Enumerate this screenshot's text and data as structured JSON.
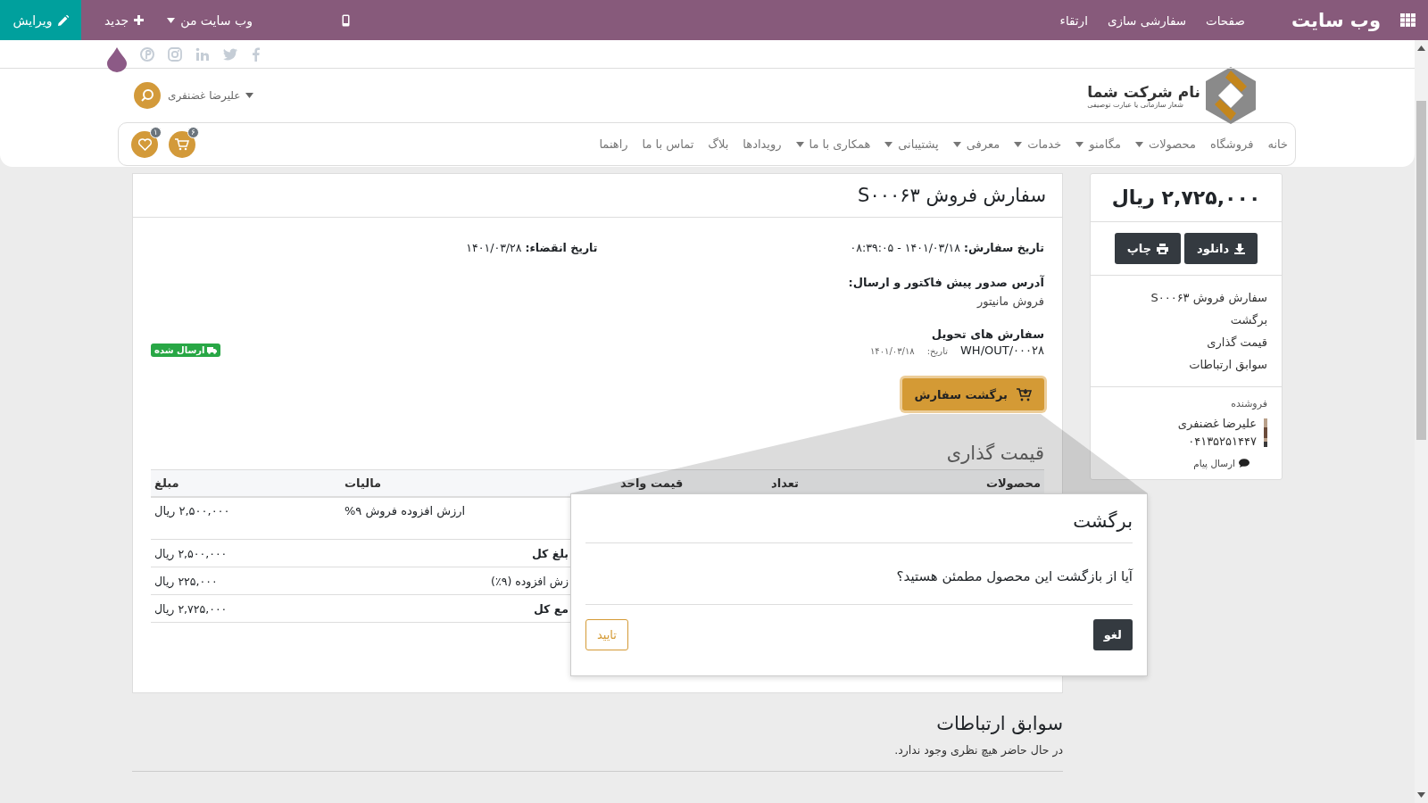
{
  "topbar": {
    "title": "وب سایت",
    "menu": [
      "صفحات",
      "سفارشی سازی",
      "ارتقاء"
    ],
    "website_menu": "وب سایت من",
    "new_button": "جدید",
    "edit_button": "ویرایش"
  },
  "header": {
    "company_name": "نام شرکت شما",
    "company_slogan": "شعار سازمانی یا عبارت توصیفی",
    "user": "علیرضا غضنفری"
  },
  "nav": {
    "items": [
      {
        "label": "خانه",
        "dropdown": false
      },
      {
        "label": "فروشگاه",
        "dropdown": false
      },
      {
        "label": "محصولات",
        "dropdown": true
      },
      {
        "label": "مگامنو",
        "dropdown": true
      },
      {
        "label": "خدمات",
        "dropdown": true
      },
      {
        "label": "معرفی",
        "dropdown": true
      },
      {
        "label": "پشتیبانی",
        "dropdown": true
      },
      {
        "label": "همکاری با ما",
        "dropdown": true
      },
      {
        "label": "رویدادها",
        "dropdown": false
      },
      {
        "label": "بلاگ",
        "dropdown": false
      },
      {
        "label": "تماس با ما",
        "dropdown": false
      },
      {
        "label": "راهنما",
        "dropdown": false
      }
    ],
    "cart_count": "۶",
    "wishlist_count": "۱"
  },
  "sidebar": {
    "total": "۲,۷۲۵,۰۰۰ ریال",
    "buttons": [
      "دانلود",
      "چاپ"
    ],
    "links": [
      "سفارش فروش S۰۰۰۶۳",
      "برگشت",
      "قیمت گذاری",
      "سوابق ارتباطات"
    ],
    "salesperson_label": "فروشنده",
    "salesperson": "علیرضا غضنفری",
    "phone": "۰۴۱۳۵۲۵۱۴۴۷",
    "message_link": "ارسال پیام"
  },
  "order": {
    "title": "سفارش فروش S۰۰۰۶۳",
    "order_date_label": "تاریخ سفارش:",
    "order_date": "۱۴۰۱/۰۳/۱۸ - ۰۸:۳۹:۰۵",
    "expiry_label": "تاریخ انقضاء:",
    "expiry": "۱۴۰۱/۰۳/۲۸",
    "address_label": "آدرس صدور پیش فاکتور و ارسال:",
    "address": "فروش مانیتور",
    "deliveries_title": "سفارش های تحویل",
    "delivery": {
      "ref": "WH/OUT/۰۰۰۲۸",
      "date_label": "تاریخ:",
      "date": "۱۴۰۱/۰۳/۱۸",
      "status": "ارسال شده"
    },
    "return_button": "برگشت سفارش"
  },
  "pricing": {
    "title": "قیمت گذاری",
    "columns": [
      "محصولات",
      "تعداد",
      "قیمت واحد",
      "مالیات",
      "مبلغ"
    ],
    "rows": [
      {
        "tax": "ارزش افزوده فروش ۹%",
        "amount": "۲,۵۰۰,۰۰۰ ریال"
      }
    ],
    "totals": [
      {
        "label": "بلغ کل",
        "amount": "۲,۵۰۰,۰۰۰ ریال",
        "bold": true
      },
      {
        "label": "زش افزوده (۹٪)",
        "amount": "۲۲۵,۰۰۰ ریال",
        "bold": false
      },
      {
        "label": "مع کل",
        "amount": "۲,۷۲۵,۰۰۰ ریال",
        "bold": true
      }
    ]
  },
  "dialog": {
    "title": "برگشت",
    "message": "آیا از بازگشت این محصول مطمئن هستید؟",
    "cancel": "لغو",
    "confirm": "تایید"
  },
  "communications": {
    "title": "سوابق ارتباطات",
    "empty": "در حال حاضر هیچ نظری وجود ندارد."
  }
}
